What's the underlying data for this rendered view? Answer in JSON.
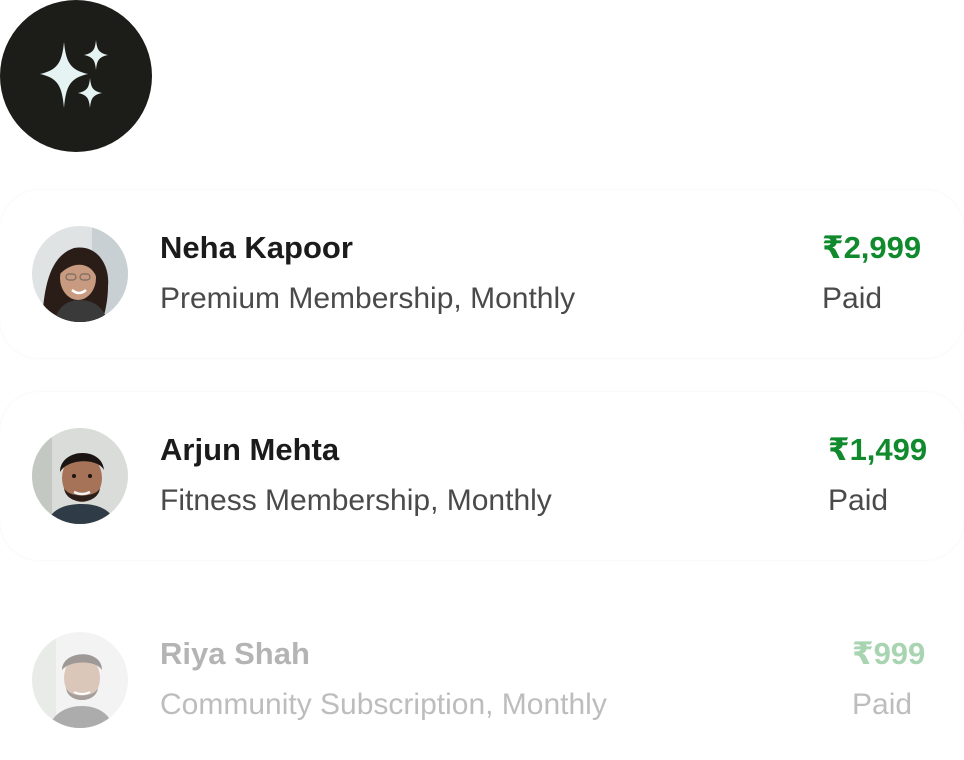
{
  "logo": {
    "icon": "sparkles-icon",
    "background": "#1c1c18",
    "icon_color": "#e6f3f3"
  },
  "transactions": [
    {
      "name": "Neha Kapoor",
      "plan": "Premium Membership, Monthly",
      "amount": "₹2,999",
      "status": "Paid",
      "avatar": "avatar-neha"
    },
    {
      "name": "Arjun Mehta",
      "plan": "Fitness Membership, Monthly",
      "amount": "₹1,499",
      "status": "Paid",
      "avatar": "avatar-arjun"
    },
    {
      "name": "Riya Shah",
      "plan": "Community Subscription, Monthly",
      "amount": "₹999",
      "status": "Paid",
      "avatar": "avatar-riya"
    }
  ],
  "colors": {
    "amount_green": "#118a2e",
    "text_dark": "#1b1b1b",
    "text_secondary": "#4a4a4a"
  }
}
